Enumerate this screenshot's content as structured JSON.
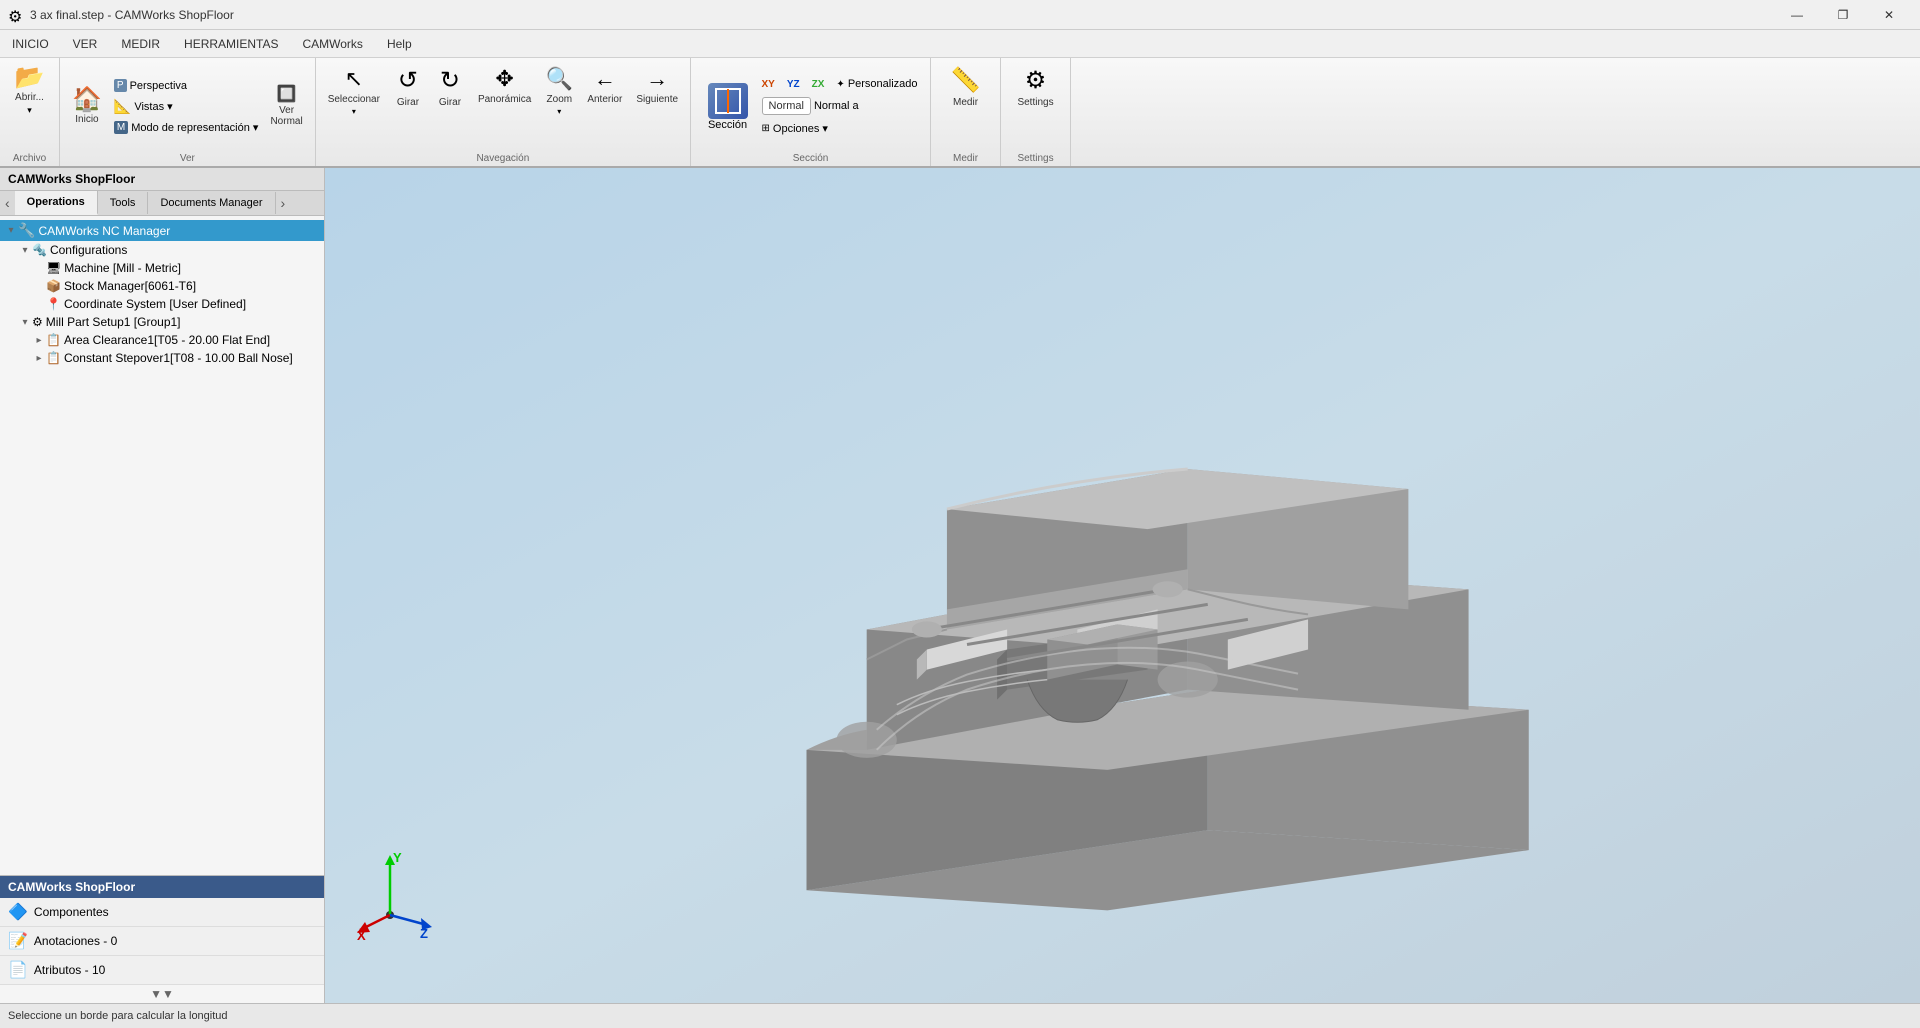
{
  "titleBar": {
    "title": "3 ax final.step - CAMWorks ShopFloor",
    "appIcon": "⚙"
  },
  "windowControls": {
    "minimize": "—",
    "restore": "❐",
    "close": "✕"
  },
  "menuBar": {
    "items": [
      "INICIO",
      "VER",
      "MEDIR",
      "HERRAMIENTAS",
      "CAMWorks",
      "Help"
    ]
  },
  "ribbon": {
    "groups": [
      {
        "label": "Archivo",
        "buttons": [
          {
            "id": "abrir",
            "label": "Abrir...",
            "icon": "📂",
            "large": true
          }
        ]
      },
      {
        "label": "Ver",
        "buttons": [
          {
            "id": "inicio",
            "label": "Inicio",
            "icon": "🏠",
            "large": true
          },
          {
            "id": "vistas",
            "label": "Vistas ▾",
            "icon": "📐",
            "large": false
          },
          {
            "id": "perspectiva",
            "label": "Perspectiva",
            "icon": "",
            "small": true
          },
          {
            "id": "modo-rep",
            "label": "Modo de representación ▾",
            "icon": "",
            "small": true
          },
          {
            "id": "ver-normal",
            "label": "Ver\nNormal",
            "icon": "🔲",
            "large": true
          }
        ]
      },
      {
        "label": "Navegación",
        "buttons": [
          {
            "id": "seleccionar",
            "label": "Seleccionar",
            "icon": "↖",
            "large": true
          },
          {
            "id": "girar1",
            "label": "Girar",
            "icon": "↺",
            "large": true
          },
          {
            "id": "girar2",
            "label": "Girar",
            "icon": "↻",
            "large": true
          },
          {
            "id": "panoramica",
            "label": "Panorámica",
            "icon": "✥",
            "large": true
          },
          {
            "id": "zoom",
            "label": "Zoom",
            "icon": "🔍",
            "large": true
          },
          {
            "id": "anterior",
            "label": "Anterior",
            "icon": "←",
            "large": true
          },
          {
            "id": "siguiente",
            "label": "Siguiente",
            "icon": "→",
            "large": true
          }
        ]
      },
      {
        "label": "Sección",
        "buttons": [
          {
            "id": "seccion",
            "label": "Sección",
            "icon": "",
            "large": true
          },
          {
            "id": "xy",
            "label": "XY",
            "small": true
          },
          {
            "id": "yz",
            "label": "YZ",
            "small": true
          },
          {
            "id": "zx",
            "label": "ZX",
            "small": true
          },
          {
            "id": "personalizado",
            "label": "Personalizado",
            "small": true
          },
          {
            "id": "normal-a",
            "label": "Normal a",
            "small": true,
            "badge": "Normal"
          },
          {
            "id": "opciones",
            "label": "Opciones ▾",
            "small": true
          }
        ]
      },
      {
        "label": "Medir",
        "buttons": [
          {
            "id": "medir",
            "label": "Medir",
            "icon": "📏",
            "large": true
          }
        ]
      },
      {
        "label": "Settings",
        "buttons": [
          {
            "id": "settings",
            "label": "Settings",
            "icon": "⚙",
            "large": true
          }
        ]
      }
    ]
  },
  "leftPanel": {
    "header": "CAMWorks ShopFloor",
    "tabs": [
      "Operations",
      "Tools",
      "Documents Manager"
    ],
    "activeTab": "Operations",
    "tree": {
      "root": "CAMWorks NC Manager",
      "items": [
        {
          "id": "nc-manager",
          "label": "CAMWorks NC Manager",
          "level": 0,
          "icon": "🔧",
          "expanded": true,
          "selected": true
        },
        {
          "id": "configurations",
          "label": "Configurations",
          "level": 1,
          "icon": "⚙",
          "expanded": true
        },
        {
          "id": "machine",
          "label": "Machine [Mill - Metric]",
          "level": 2,
          "icon": "🖥"
        },
        {
          "id": "stock",
          "label": "Stock Manager[6061-T6]",
          "level": 2,
          "icon": "📦"
        },
        {
          "id": "coordinate",
          "label": "Coordinate System [User Defined]",
          "level": 2,
          "icon": "📍"
        },
        {
          "id": "mill-setup",
          "label": "Mill Part Setup1 [Group1]",
          "level": 1,
          "icon": "⚙",
          "expanded": true
        },
        {
          "id": "area-clearance",
          "label": "Area Clearance1[T05 - 20.00 Flat End]",
          "level": 2,
          "icon": "📋"
        },
        {
          "id": "constant-stepover",
          "label": "Constant Stepover1[T08 - 10.00 Ball Nose]",
          "level": 2,
          "icon": "📋"
        }
      ]
    }
  },
  "bottomPanel": {
    "header": "CAMWorks ShopFloor",
    "items": [
      {
        "id": "componentes",
        "label": "Componentes",
        "icon": "🔷"
      },
      {
        "id": "anotaciones",
        "label": "Anotaciones - 0",
        "icon": "📝"
      },
      {
        "id": "atributos",
        "label": "Atributos - 10",
        "icon": "📄"
      }
    ],
    "scrollDown": "▼▼"
  },
  "statusBar": {
    "message": "Seleccione un borde para calcular la longitud"
  },
  "viewport": {
    "bgGradientStart": "#b0cce0",
    "bgGradientEnd": "#d8eaf4"
  },
  "axisIndicator": {
    "x": "X",
    "y": "Y",
    "z": "Z"
  }
}
